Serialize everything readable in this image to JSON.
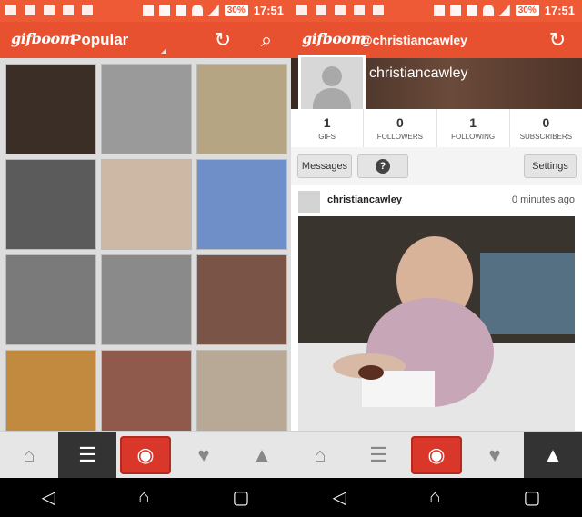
{
  "left": {
    "status": {
      "battery": "30%",
      "time": "17:51"
    },
    "app": {
      "logo": "gifboom",
      "title": "Popular"
    },
    "grid": {
      "tiles": [
        {
          "bg": "#3b2e27"
        },
        {
          "bg": "#9a9a9a"
        },
        {
          "bg": "#b5a583"
        },
        {
          "bg": "#5b5b5b"
        },
        {
          "bg": "#cdb8a5"
        },
        {
          "bg": "#6f8fc9"
        },
        {
          "bg": "#7a7a7a"
        },
        {
          "bg": "#8a8a8a"
        },
        {
          "bg": "#7a5446"
        },
        {
          "bg": "#c28a3e"
        },
        {
          "bg": "#8f5a4b"
        },
        {
          "bg": "#b7a996"
        }
      ]
    }
  },
  "right": {
    "status": {
      "battery": "30%",
      "time": "17:51"
    },
    "app": {
      "logo": "gifboom",
      "handle": "@christiancawley"
    },
    "profile": {
      "username": "christiancawley",
      "stats": [
        {
          "value": "1",
          "label": "GIFS"
        },
        {
          "value": "0",
          "label": "FOLLOWERS"
        },
        {
          "value": "1",
          "label": "FOLLOWING"
        },
        {
          "value": "0",
          "label": "SUBSCRIBERS"
        }
      ],
      "buttons": {
        "messages": "Messages",
        "help": "?",
        "settings": "Settings"
      }
    },
    "post": {
      "author": "christiancawley",
      "time": "0 minutes ago"
    }
  },
  "colors": {
    "brand": "#e8512f",
    "status": "#ee5a36",
    "camera": "#d9372a",
    "active_nav": "#333333"
  },
  "icons": [
    "refresh-icon",
    "search-icon",
    "home-icon",
    "list-icon",
    "camera-icon",
    "chat-icon",
    "person-icon",
    "back-icon",
    "home-nav-icon",
    "recents-icon"
  ]
}
